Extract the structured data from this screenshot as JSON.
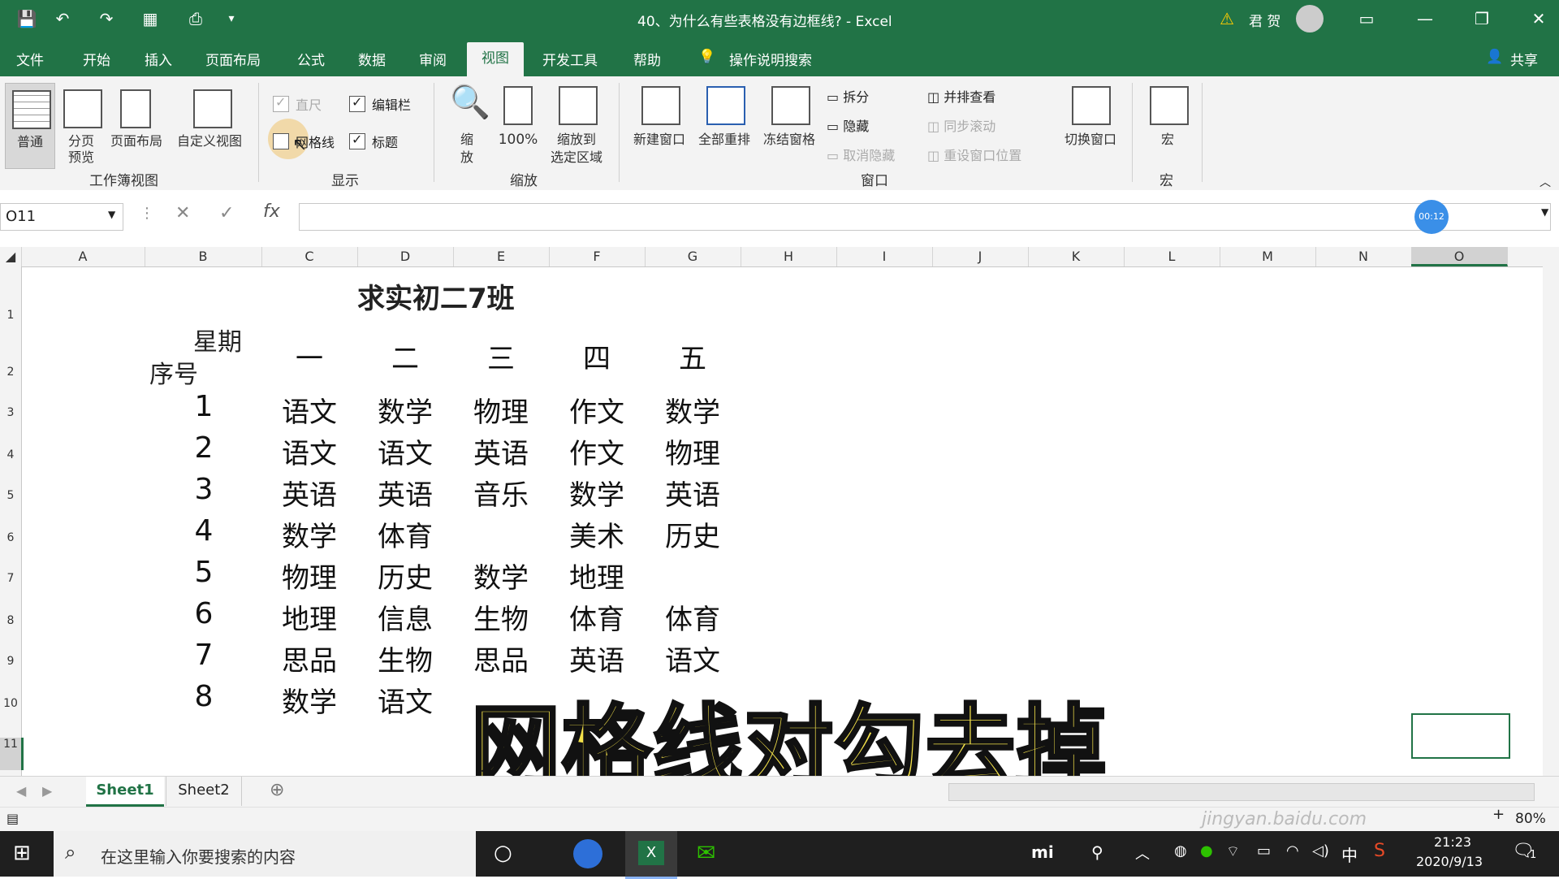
{
  "titlebar": {
    "doc_title": "40、为什么有些表格没有边框线?  -  Excel",
    "user": "君 贺"
  },
  "tabs": [
    "文件",
    "开始",
    "插入",
    "页面布局",
    "公式",
    "数据",
    "审阅",
    "视图",
    "开发工具",
    "帮助"
  ],
  "active_tab": "视图",
  "search_hint": "操作说明搜索",
  "share": "共享",
  "ribbon": {
    "workbook_view": {
      "label": "工作簿视图",
      "normal": "普通",
      "page_break_1": "分页",
      "page_break_2": "预览",
      "page_layout": "页面布局",
      "custom_view": "自定义视图"
    },
    "show": {
      "label": "显示",
      "ruler": "直尺",
      "formula_bar": "编辑栏",
      "gridlines": "网格线",
      "headings": "标题"
    },
    "zoom": {
      "label": "缩放",
      "zoom_1": "缩",
      "zoom_2": "放",
      "hundred": "100%",
      "to_sel_1": "缩放到",
      "to_sel_2": "选定区域"
    },
    "window": {
      "label": "窗口",
      "new_window": "新建窗口",
      "arrange_all": "全部重排",
      "freeze": "冻结窗格",
      "split": "拆分",
      "hide": "隐藏",
      "unhide": "取消隐藏",
      "side_by_side": "并排查看",
      "sync_scroll": "同步滚动",
      "reset_pos": "重设窗口位置",
      "switch": "切换窗口"
    },
    "macros": {
      "label": "宏",
      "macro": "宏"
    }
  },
  "formula_bar": {
    "name_box": "O11",
    "timer": "00:12"
  },
  "columns": [
    "A",
    "B",
    "C",
    "D",
    "E",
    "F",
    "G",
    "H",
    "I",
    "J",
    "K",
    "L",
    "M",
    "N",
    "O"
  ],
  "selected_column": "O",
  "rows": [
    "1",
    "2",
    "3",
    "4",
    "5",
    "6",
    "7",
    "8",
    "9",
    "10",
    "11"
  ],
  "sheet": {
    "title": "求实初二7班",
    "header_week": "星期",
    "header_index": "序号",
    "days": [
      "一",
      "二",
      "三",
      "四",
      "五"
    ],
    "schedule": [
      {
        "n": "1",
        "c": [
          "语文",
          "数学",
          "物理",
          "作文",
          "数学"
        ]
      },
      {
        "n": "2",
        "c": [
          "语文",
          "语文",
          "英语",
          "作文",
          "物理"
        ]
      },
      {
        "n": "3",
        "c": [
          "英语",
          "英语",
          "音乐",
          "数学",
          "英语"
        ]
      },
      {
        "n": "4",
        "c": [
          "数学",
          "体育",
          "",
          "美术",
          "历史"
        ]
      },
      {
        "n": "5",
        "c": [
          "物理",
          "历史",
          "数学",
          "地理",
          ""
        ]
      },
      {
        "n": "6",
        "c": [
          "地理",
          "信息",
          "生物",
          "体育",
          "体育"
        ]
      },
      {
        "n": "7",
        "c": [
          "思品",
          "生物",
          "思品",
          "英语",
          "语文"
        ]
      },
      {
        "n": "8",
        "c": [
          "数学",
          "语文",
          "",
          "",
          ""
        ]
      }
    ]
  },
  "overlay_caption": "网格线对勾去掉",
  "sheet_tabs": [
    "Sheet1",
    "Sheet2"
  ],
  "active_sheet": "Sheet1",
  "status": {
    "zoom": "80%",
    "watermark": "jingyan.baidu.com"
  },
  "taskbar": {
    "search_placeholder": "在这里输入你要搜索的内容",
    "time": "21:23",
    "date": "2020/9/13",
    "ime": "中",
    "notif": "1"
  },
  "colors": {
    "excel_green": "#217346",
    "ribbon_bg": "#f3f3f3",
    "taskbar": "#1f1f1f",
    "caption": "#f4e24a"
  }
}
